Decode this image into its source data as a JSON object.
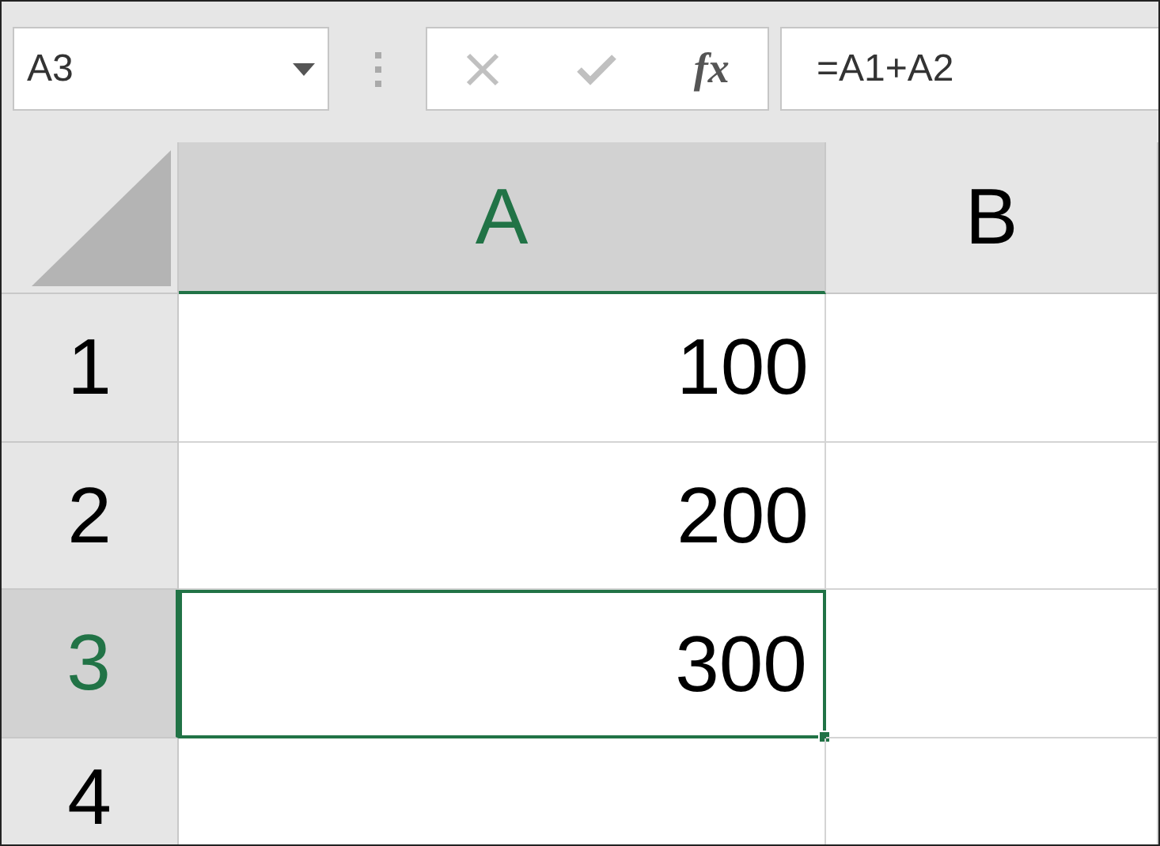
{
  "name_box": {
    "value": "A3"
  },
  "formula_bar": {
    "function_label": "fx",
    "value": "=A1+A2"
  },
  "columns": [
    {
      "label": "A",
      "selected": true
    },
    {
      "label": "B",
      "selected": false
    }
  ],
  "rows": [
    {
      "label": "1",
      "selected": false,
      "cells": [
        "100"
      ]
    },
    {
      "label": "2",
      "selected": false,
      "cells": [
        "200"
      ]
    },
    {
      "label": "3",
      "selected": true,
      "cells": [
        "300"
      ]
    },
    {
      "label": "4",
      "selected": false
    }
  ]
}
